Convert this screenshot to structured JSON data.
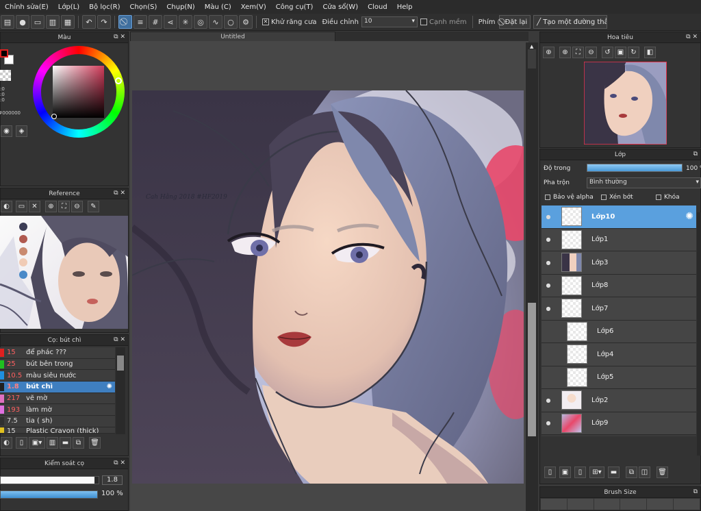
{
  "menu": [
    "Chỉnh sửa(E)",
    "Lớp(L)",
    "Bộ lọc(R)",
    "Chọn(S)",
    "Chụp(N)",
    "Màu (C)",
    "Xem(V)",
    "Công cụ(T)",
    "Cửa sổ(W)",
    "Cloud",
    "Help"
  ],
  "toolbar": {
    "antialias_label": "Khử răng cưa",
    "adjust_label": "Điều chỉnh",
    "adjust_value": "10",
    "edge_label": "Cạnh mềm",
    "key_label": "Phím",
    "reset_label": "Đặt lại",
    "straight_label": "Tạo một đường thẳng"
  },
  "doc_tab": "Untitled",
  "color_panel": {
    "title": "Màu",
    "hex": "#000000",
    "h": "0",
    "s": "0",
    "v": "0"
  },
  "reference_panel": {
    "title": "Reference"
  },
  "brush_panel": {
    "title": "Cọ: bút chì",
    "items": [
      {
        "size": "15",
        "name": "để phác ???",
        "color": "#e02020"
      },
      {
        "size": "25",
        "name": "bút bên trong",
        "color": "#20c020"
      },
      {
        "size": "10.5",
        "name": "màu siêu nước",
        "color": "#2090e0"
      },
      {
        "size": "1.8",
        "name": "bút chì",
        "color": "#202020"
      },
      {
        "size": "217",
        "name": "vẽ mờ",
        "color": "#e070c0"
      },
      {
        "size": "193",
        "name": "làm mờ",
        "color": "#e070e0"
      },
      {
        "size": "7.5",
        "name": "tia ( sh)",
        "color": "#303030"
      },
      {
        "size": "15",
        "name": "Plastic Crayon (thick)",
        "color": "#e0c020"
      }
    ]
  },
  "brush_control": {
    "title": "Kiểm soát cọ",
    "size": "1.8",
    "opacity": "100 %",
    "size_fraction": 0.96,
    "opacity_fraction": 1.0
  },
  "navigator": {
    "title": "Hoa tiêu"
  },
  "layers_panel": {
    "title": "Lớp",
    "opacity_label": "Độ trong",
    "opacity_value": "100 %",
    "blend_label": "Pha trộn",
    "blend_value": "Bình thường",
    "protect_alpha": "Bảo vệ alpha",
    "clipping": "Xén bớt",
    "lock": "Khóa",
    "layers": [
      "Lớp10",
      "Lớp1",
      "Lớp3",
      "Lớp8",
      "Lớp7",
      "Lớp6",
      "Lớp4",
      "Lớp5",
      "Lớp2",
      "Lớp9"
    ]
  },
  "brush_size_panel": {
    "title": "Brush Size"
  },
  "signature_text": "Cah Hằng 2018 #HF2019"
}
